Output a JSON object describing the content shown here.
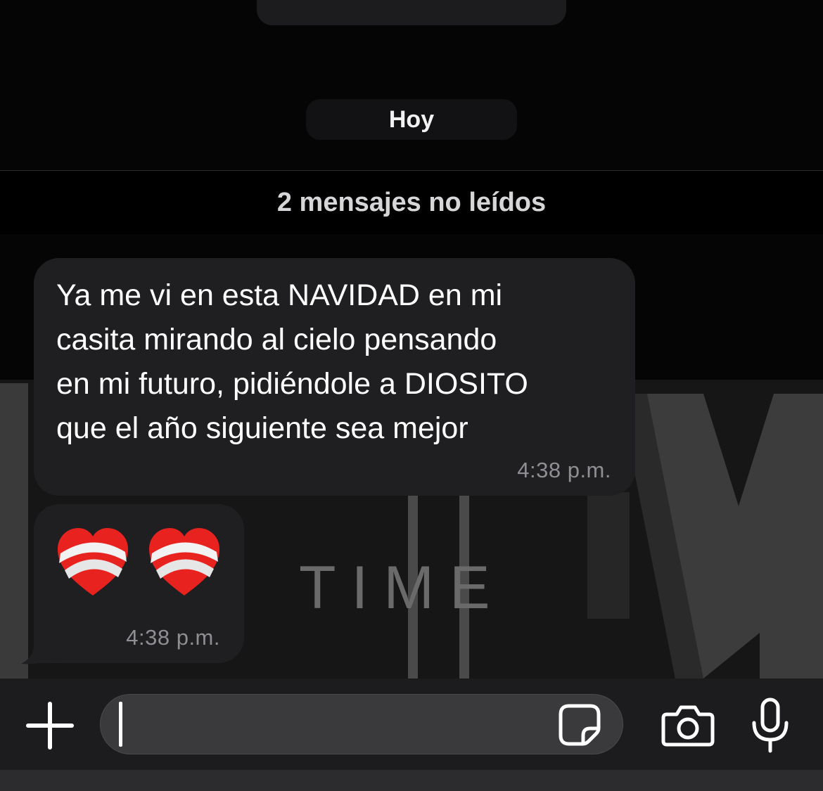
{
  "chat": {
    "date_label": "Hoy",
    "unread_label": "2 mensajes no leídos",
    "wallpaper_text": "TIME",
    "messages": [
      {
        "text": "Ya me vi en esta NAVIDAD en mi\ncasita mirando al cielo pensando\nen mi futuro, pidiéndole a DIOSITO\nque el año siguiente sea mejor",
        "time": "4:38 p.m."
      },
      {
        "emoji": "❤️‍🩹",
        "emoji_count": 2,
        "time": "4:38 p.m."
      }
    ]
  },
  "composer": {
    "value": "",
    "icons": [
      "plus-icon",
      "sticker-icon",
      "camera-icon",
      "microphone-icon"
    ]
  },
  "colors": {
    "background": "#000000",
    "bubble": "#1f1f21",
    "input_bar": "#1c1c1e",
    "text_field": "#3a3a3c",
    "timestamp": "#8e8e93"
  }
}
